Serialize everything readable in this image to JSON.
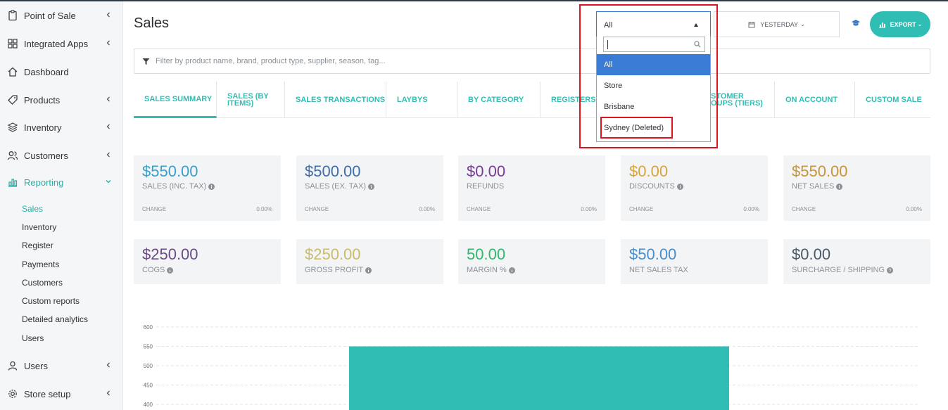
{
  "sidebar": {
    "items": [
      {
        "label": "Point of Sale",
        "icon": "clipboard-icon",
        "chevron": true
      },
      {
        "label": "Integrated Apps",
        "icon": "grid-icon",
        "chevron": true
      },
      {
        "label": "Dashboard",
        "icon": "home-icon",
        "chevron": false
      },
      {
        "label": "Products",
        "icon": "tag-icon",
        "chevron": true
      },
      {
        "label": "Inventory",
        "icon": "layers-icon",
        "chevron": true
      },
      {
        "label": "Customers",
        "icon": "users-icon",
        "chevron": true
      },
      {
        "label": "Reporting",
        "icon": "bar-chart-icon",
        "chevron": true,
        "active": true
      },
      {
        "label": "Users",
        "icon": "user-icon",
        "chevron": true
      },
      {
        "label": "Store setup",
        "icon": "gear-icon",
        "chevron": true
      }
    ],
    "reporting_sub": [
      "Sales",
      "Inventory",
      "Register",
      "Payments",
      "Customers",
      "Custom reports",
      "Detailed analytics",
      "Users"
    ],
    "active_sub": "Sales"
  },
  "header": {
    "title": "Sales",
    "date_label": "YESTERDAY",
    "export_label": "EXPORT"
  },
  "filter": {
    "placeholder": "Filter by product name, brand, product type, supplier, season, tag..."
  },
  "tabs": [
    {
      "label": "SALES SUMMARY",
      "active": true
    },
    {
      "label": "SALES (BY ITEMS)"
    },
    {
      "label": "SALES TRANSACTIONS"
    },
    {
      "label": "LAYBYS"
    },
    {
      "label": "BY CATEGORY"
    },
    {
      "label": "REGISTERS"
    },
    {
      "label": "STOMER OUPS (TIERS)"
    },
    {
      "label": "ON ACCOUNT"
    },
    {
      "label": "CUSTOM SALE"
    }
  ],
  "metrics_row1": [
    {
      "value": "$550.00",
      "label": "SALES (INC. TAX)",
      "info": true,
      "change_label": "CHANGE",
      "change": "0.00%",
      "color": "#3a9fc9"
    },
    {
      "value": "$500.00",
      "label": "SALES (EX. TAX)",
      "info": true,
      "change_label": "CHANGE",
      "change": "0.00%",
      "color": "#3f6da8"
    },
    {
      "value": "$0.00",
      "label": "REFUNDS",
      "info": false,
      "change_label": "CHANGE",
      "change": "0.00%",
      "color": "#7a3a9c"
    },
    {
      "value": "$0.00",
      "label": "DISCOUNTS",
      "info": true,
      "change_label": "CHANGE",
      "change": "0.00%",
      "color": "#d9a43c"
    },
    {
      "value": "$550.00",
      "label": "NET SALES",
      "info": true,
      "change_label": "CHANGE",
      "change": "0.00%",
      "color": "#c9953a"
    }
  ],
  "metrics_row2": [
    {
      "value": "$250.00",
      "label": "COGS",
      "info": true,
      "color": "#6b4a86"
    },
    {
      "value": "$250.00",
      "label": "GROSS PROFIT",
      "info": true,
      "color": "#c9bc6a"
    },
    {
      "value": "50.00",
      "label": "MARGIN %",
      "info": true,
      "color": "#2fb86a"
    },
    {
      "value": "$50.00",
      "label": "NET SALES TAX",
      "info": false,
      "color": "#4a8ec9"
    },
    {
      "value": "$0.00",
      "label": "SURCHARGE / SHIPPING",
      "info": true,
      "color": "#4a5a6a"
    }
  ],
  "store_dropdown": {
    "selected": "All",
    "options": [
      "All",
      "Store",
      "Brisbane",
      "Sydney (Deleted)"
    ],
    "highlighted": "All"
  },
  "chart_data": {
    "type": "bar",
    "y_ticks": [
      600,
      550,
      500,
      450,
      400
    ],
    "ylim": [
      400,
      600
    ],
    "values": [
      550
    ],
    "color": "#2fbdb4",
    "grid": true
  },
  "colors": {
    "accent": "#2fbdb4",
    "highlight_box": "#e0141e",
    "select_blue": "#3a7bd5"
  }
}
